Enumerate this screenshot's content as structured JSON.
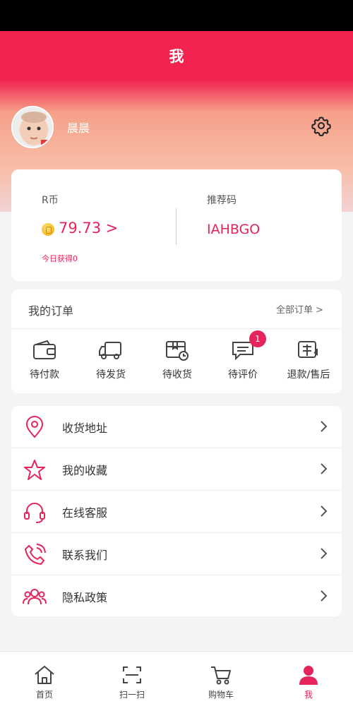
{
  "header": {
    "title": "我"
  },
  "profile": {
    "username": "晨晨"
  },
  "wallet": {
    "currency_label": "R币",
    "balance": "79.73 >",
    "today_label": "今日获得0",
    "referral_label": "推荐码",
    "referral_code": "IAHBGO"
  },
  "orders": {
    "title": "我的订单",
    "all_label": "全部订单 >",
    "items": [
      {
        "label": "待付款",
        "icon": "wallet-icon"
      },
      {
        "label": "待发货",
        "icon": "truck-icon"
      },
      {
        "label": "待收货",
        "icon": "package-clock-icon"
      },
      {
        "label": "待评价",
        "icon": "comment-icon",
        "badge": "1"
      },
      {
        "label": "退款/售后",
        "icon": "after-sale-icon"
      }
    ]
  },
  "menu": [
    {
      "label": "收货地址",
      "icon": "location-icon"
    },
    {
      "label": "我的收藏",
      "icon": "star-icon"
    },
    {
      "label": "在线客服",
      "icon": "headset-icon"
    },
    {
      "label": "联系我们",
      "icon": "phone-icon"
    },
    {
      "label": "隐私政策",
      "icon": "users-icon"
    }
  ],
  "tabbar": {
    "items": [
      {
        "label": "首页",
        "icon": "home-icon"
      },
      {
        "label": "扫一扫",
        "icon": "scan-icon"
      },
      {
        "label": "购物车",
        "icon": "cart-icon"
      },
      {
        "label": "我",
        "icon": "profile-icon",
        "active": true
      }
    ]
  },
  "colors": {
    "accent": "#e5245b",
    "header": "#f2234f"
  }
}
